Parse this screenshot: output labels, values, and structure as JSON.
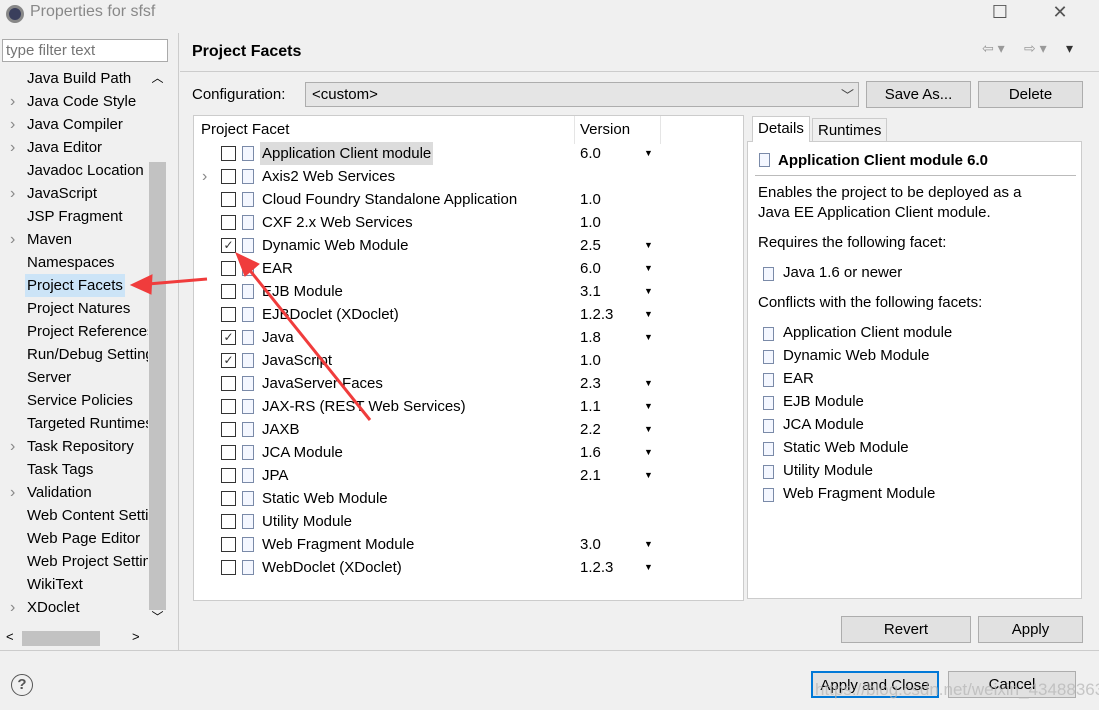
{
  "window": {
    "title": "Properties for sfsf",
    "minimize": "☐",
    "close": "✕"
  },
  "sidebar": {
    "filter_placeholder": "type filter text",
    "items": [
      {
        "label": "Java Build Path",
        "exp": false
      },
      {
        "label": "Java Code Style",
        "exp": true
      },
      {
        "label": "Java Compiler",
        "exp": true
      },
      {
        "label": "Java Editor",
        "exp": true
      },
      {
        "label": "Javadoc Location",
        "exp": false
      },
      {
        "label": "JavaScript",
        "exp": true
      },
      {
        "label": "JSP Fragment",
        "exp": false
      },
      {
        "label": "Maven",
        "exp": true
      },
      {
        "label": "Namespaces",
        "exp": false
      },
      {
        "label": "Project Facets",
        "exp": false,
        "selected": true
      },
      {
        "label": "Project Natures",
        "exp": false
      },
      {
        "label": "Project References",
        "exp": false
      },
      {
        "label": "Run/Debug Settings",
        "exp": false
      },
      {
        "label": "Server",
        "exp": false
      },
      {
        "label": "Service Policies",
        "exp": false
      },
      {
        "label": "Targeted Runtimes",
        "exp": false
      },
      {
        "label": "Task Repository",
        "exp": true
      },
      {
        "label": "Task Tags",
        "exp": false
      },
      {
        "label": "Validation",
        "exp": true
      },
      {
        "label": "Web Content Settings",
        "exp": false
      },
      {
        "label": "Web Page Editor",
        "exp": false
      },
      {
        "label": "Web Project Settings",
        "exp": false
      },
      {
        "label": "WikiText",
        "exp": false
      },
      {
        "label": "XDoclet",
        "exp": true
      }
    ]
  },
  "page": {
    "title": "Project Facets",
    "configuration_label": "Configuration:",
    "configuration_value": "<custom>",
    "save_as": "Save As...",
    "delete": "Delete"
  },
  "facets": {
    "col_facet": "Project Facet",
    "col_version": "Version",
    "rows": [
      {
        "name": "Application Client module",
        "version": "6.0",
        "checked": false,
        "dropdown": true,
        "highlight": true
      },
      {
        "name": "Axis2 Web Services",
        "version": "",
        "checked": false,
        "dropdown": false,
        "expandable": true
      },
      {
        "name": "Cloud Foundry Standalone Application",
        "version": "1.0",
        "checked": false,
        "dropdown": false
      },
      {
        "name": "CXF 2.x Web Services",
        "version": "1.0",
        "checked": false,
        "dropdown": false
      },
      {
        "name": "Dynamic Web Module",
        "version": "2.5",
        "checked": true,
        "dropdown": true
      },
      {
        "name": "EAR",
        "version": "6.0",
        "checked": false,
        "dropdown": true
      },
      {
        "name": "EJB Module",
        "version": "3.1",
        "checked": false,
        "dropdown": true
      },
      {
        "name": "EJBDoclet (XDoclet)",
        "version": "1.2.3",
        "checked": false,
        "dropdown": true
      },
      {
        "name": "Java",
        "version": "1.8",
        "checked": true,
        "dropdown": true
      },
      {
        "name": "JavaScript",
        "version": "1.0",
        "checked": true,
        "dropdown": false
      },
      {
        "name": "JavaServer Faces",
        "version": "2.3",
        "checked": false,
        "dropdown": true
      },
      {
        "name": "JAX-RS (REST Web Services)",
        "version": "1.1",
        "checked": false,
        "dropdown": true
      },
      {
        "name": "JAXB",
        "version": "2.2",
        "checked": false,
        "dropdown": true
      },
      {
        "name": "JCA Module",
        "version": "1.6",
        "checked": false,
        "dropdown": true
      },
      {
        "name": "JPA",
        "version": "2.1",
        "checked": false,
        "dropdown": true
      },
      {
        "name": "Static Web Module",
        "version": "",
        "checked": false,
        "dropdown": false
      },
      {
        "name": "Utility Module",
        "version": "",
        "checked": false,
        "dropdown": false
      },
      {
        "name": "Web Fragment Module",
        "version": "3.0",
        "checked": false,
        "dropdown": true
      },
      {
        "name": "WebDoclet (XDoclet)",
        "version": "1.2.3",
        "checked": false,
        "dropdown": true
      }
    ]
  },
  "details": {
    "tabs": [
      "Details",
      "Runtimes"
    ],
    "heading": "Application Client module 6.0",
    "desc1": "Enables the project to be deployed as a",
    "desc2": "Java EE Application Client module.",
    "requires_label": "Requires the following facet:",
    "requires": [
      "Java 1.6 or newer"
    ],
    "conflicts_label": "Conflicts with the following facets:",
    "conflicts": [
      "Application Client module",
      "Dynamic Web Module",
      "EAR",
      "EJB Module",
      "JCA Module",
      "Static Web Module",
      "Utility Module",
      "Web Fragment Module"
    ]
  },
  "buttons": {
    "revert": "Revert",
    "apply": "Apply",
    "apply_close": "Apply and Close",
    "cancel": "Cancel",
    "help": "?"
  },
  "watermark": "https://blog.csdn.net/weixin_43488363",
  "colors": {
    "annotation_arrow": "#f03c3c",
    "selection": "#cce4f7",
    "default_button_border": "#0078d7"
  }
}
